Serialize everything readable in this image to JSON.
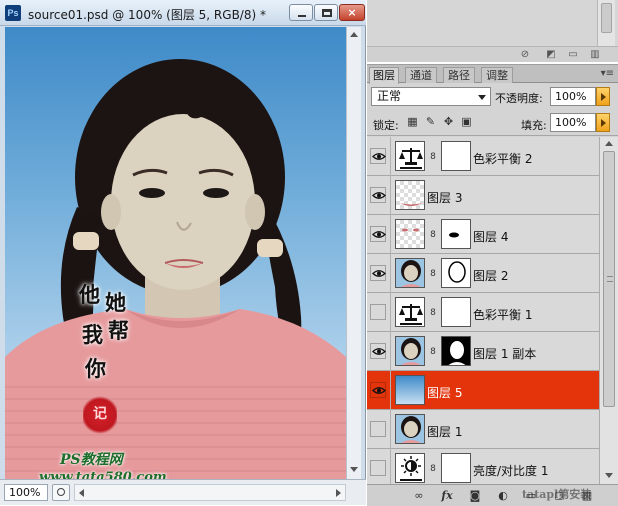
{
  "document": {
    "app_icon": "Ps",
    "title": "source01.psd @ 100% (图层 5, RGB/8) *",
    "close_glyph": "×",
    "zoom": "100%",
    "canvas_overlay": {
      "calligraphy": [
        "他",
        "她",
        "我",
        "帮",
        "你"
      ],
      "seal_text": "记",
      "watermark_line1": "PS教程网",
      "watermark_line2": "www.tata580.com"
    }
  },
  "layers_panel": {
    "tabs": [
      {
        "label": "图层",
        "active": true
      },
      {
        "label": "通道",
        "active": false
      },
      {
        "label": "路径",
        "active": false
      },
      {
        "label": "调整",
        "active": false
      }
    ],
    "blend_mode": "正常",
    "opacity_label": "不透明度:",
    "opacity_value": "100%",
    "lock_label": "锁定:",
    "fill_label": "填充:",
    "fill_value": "100%",
    "layers": [
      {
        "name": "色彩平衡 2",
        "visible": true,
        "selected": false,
        "kind": "balance-adjust"
      },
      {
        "name": "图层 3",
        "visible": true,
        "selected": false,
        "kind": "pixel-lips"
      },
      {
        "name": "图层 4",
        "visible": true,
        "selected": false,
        "kind": "pixel-eye-mask"
      },
      {
        "name": "图层 2",
        "visible": true,
        "selected": false,
        "kind": "pixel-photo-mask"
      },
      {
        "name": "色彩平衡 1",
        "visible": false,
        "selected": false,
        "kind": "balance-adjust"
      },
      {
        "name": "图层 1 副本",
        "visible": true,
        "selected": false,
        "kind": "pixel-photo-mask-black"
      },
      {
        "name": "图层 5",
        "visible": true,
        "selected": true,
        "kind": "gradient"
      },
      {
        "name": "图层 1",
        "visible": false,
        "selected": false,
        "kind": "pixel-photo"
      },
      {
        "name": "亮度/对比度 1",
        "visible": false,
        "selected": false,
        "kind": "brightness-adjust"
      }
    ]
  },
  "corner_watermark": "tatapl第安装",
  "colors": {
    "selected_row": "#e3340b",
    "panel_bg": "#d4d4d4",
    "accent_orange": "#f0a21a"
  }
}
